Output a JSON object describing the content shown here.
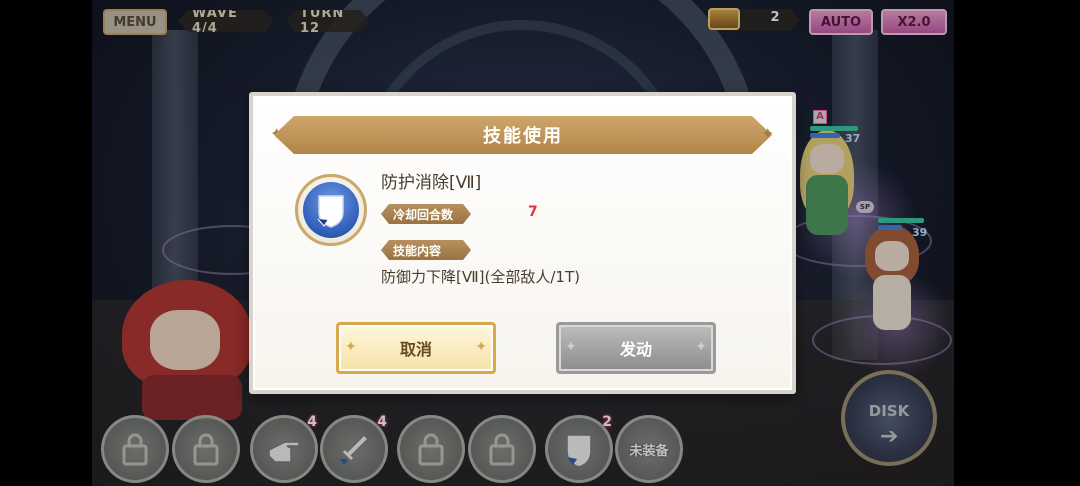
{
  "hud": {
    "menu_label": "MENU",
    "wave_text": "WAVE  4/4",
    "turn_text": "TURN 12",
    "chest_count": "2",
    "auto_label": "AUTO",
    "speed_label": "X2.0"
  },
  "allies": {
    "top": {
      "tag": "A",
      "hp": "37"
    },
    "bottom": {
      "tag": "SP",
      "hp": "39"
    }
  },
  "disk": {
    "label": "DISK"
  },
  "dialog": {
    "title": "技能使用",
    "skill_name": "防护消除[Ⅶ]",
    "cooldown_label": "冷却回合数",
    "cooldown_value": "7",
    "content_label": "技能内容",
    "skill_desc": "防御力下降[Ⅶ](全部敌人/1T)",
    "cancel_label": "取消",
    "activate_label": "发动"
  },
  "skill_bar": [
    {
      "type": "locked"
    },
    {
      "type": "locked"
    },
    {
      "type": "skill",
      "icon": "pointing-hand-icon",
      "badge": "4"
    },
    {
      "type": "skill",
      "icon": "sword-down-icon",
      "badge": "4"
    },
    {
      "type": "locked"
    },
    {
      "type": "locked"
    },
    {
      "type": "skill",
      "icon": "shield-break-icon",
      "badge": "2"
    },
    {
      "type": "text",
      "label": "未装备"
    }
  ],
  "colors": {
    "accent_gold": "#b28548",
    "cooldown_red": "#e0343a",
    "auto_pink": "#c55ca5"
  }
}
